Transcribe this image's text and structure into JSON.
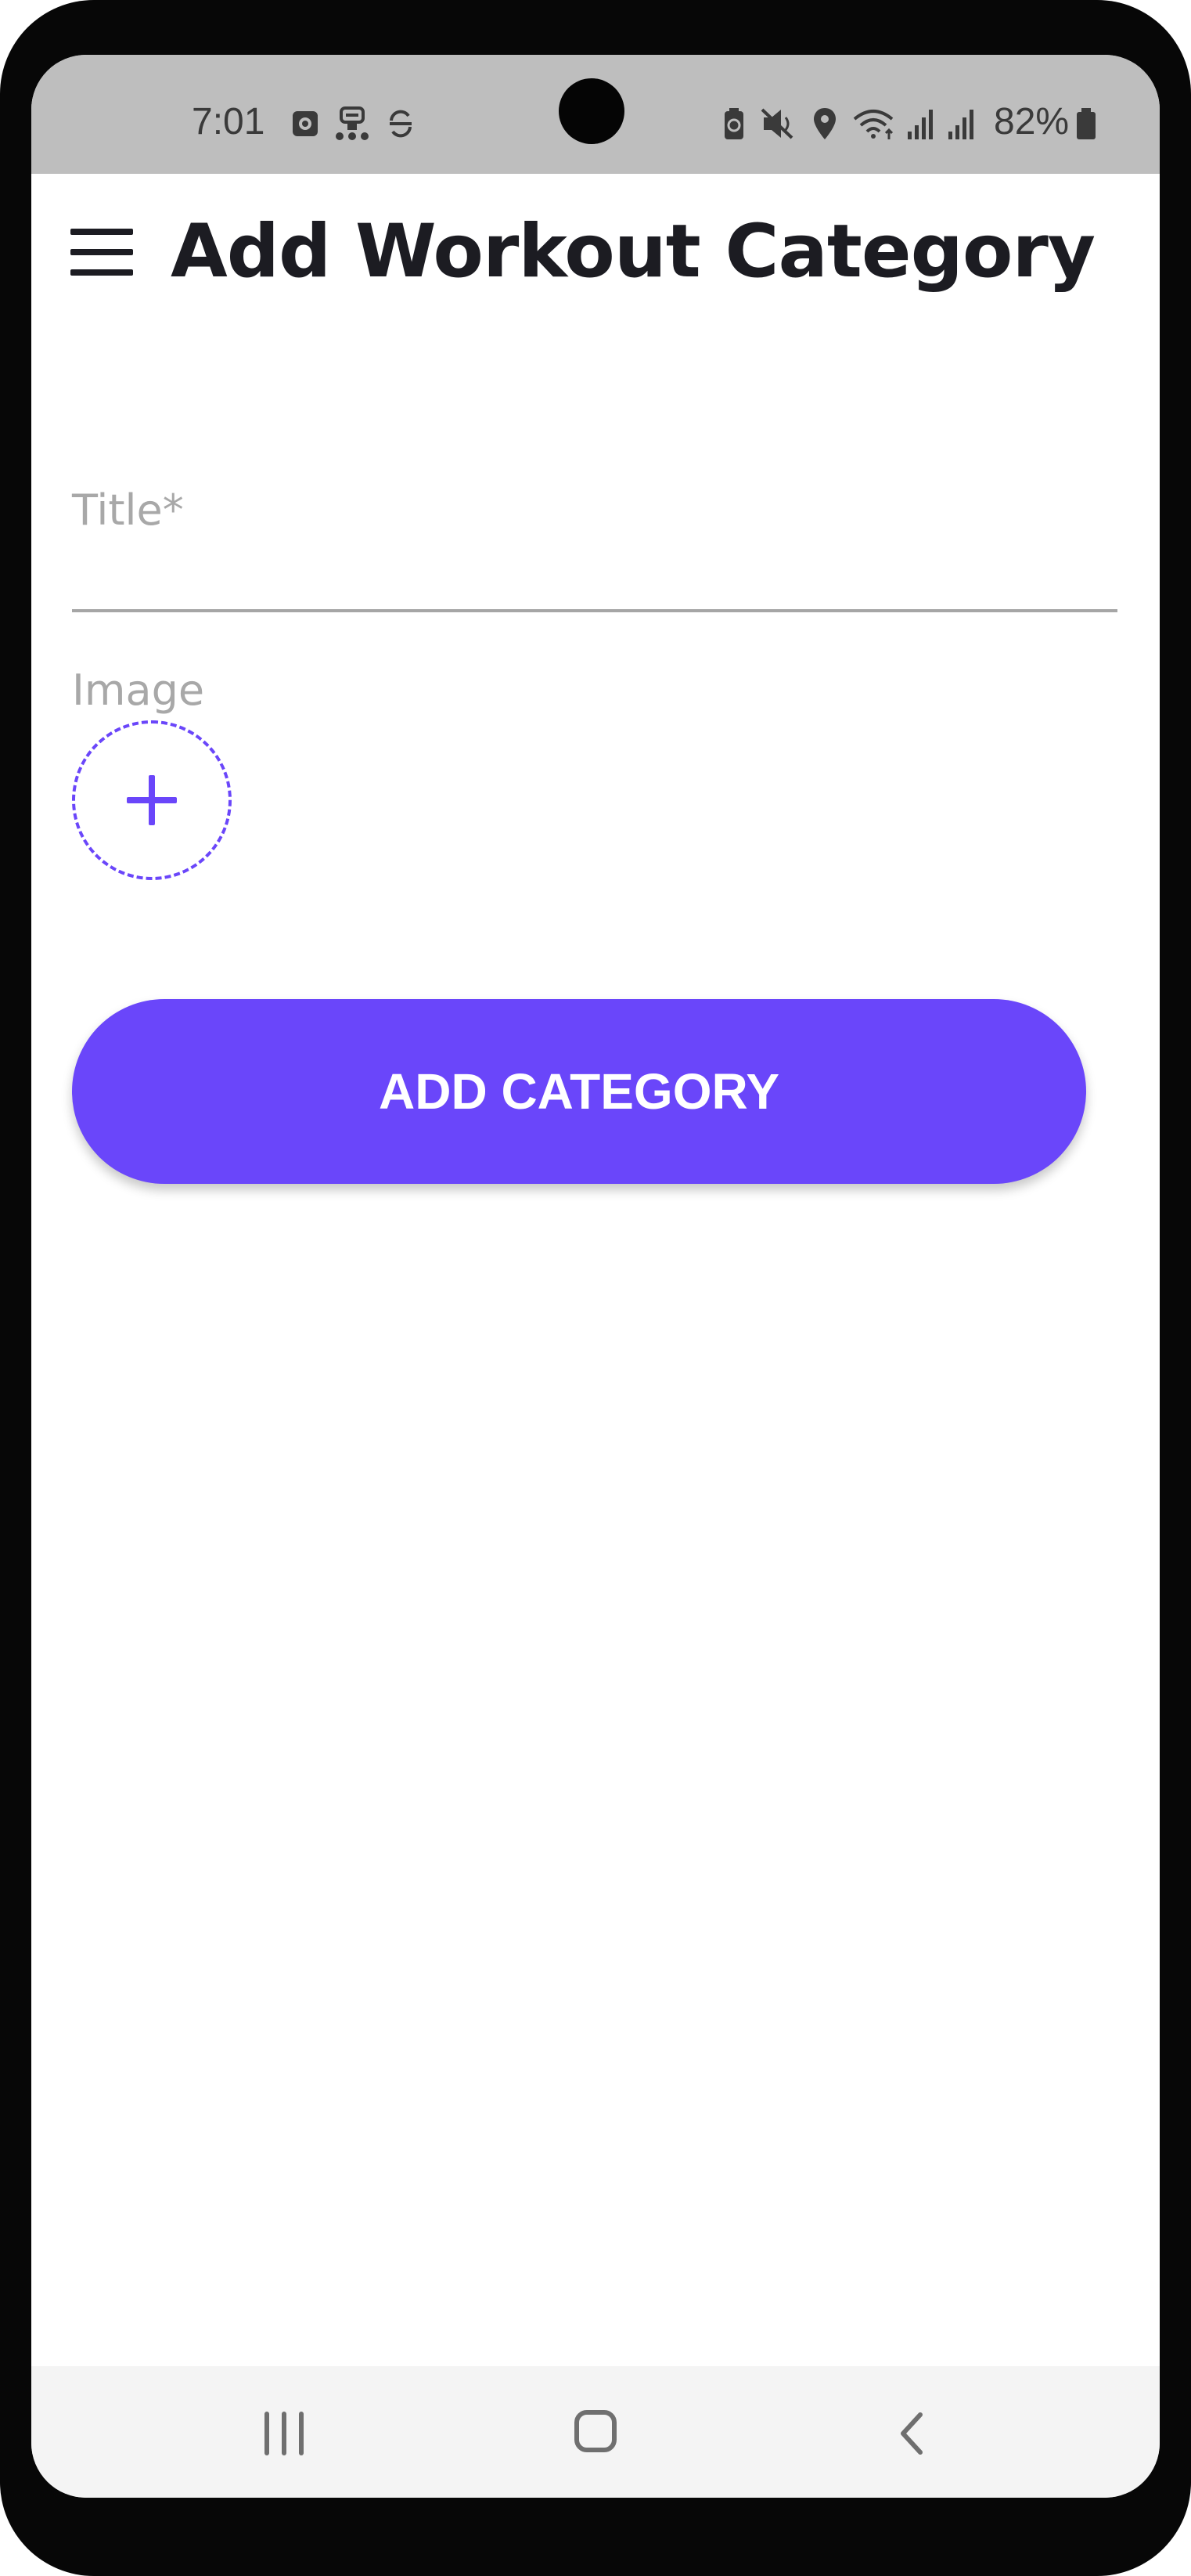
{
  "status_bar": {
    "time": "7:01",
    "battery_percent": "82%",
    "icons": [
      "app-notification-icon",
      "robot-icon",
      "sync-icon",
      "battery-saver-icon",
      "mute-icon",
      "location-icon",
      "wifi-icon",
      "signal-icon",
      "signal-icon",
      "battery-icon"
    ]
  },
  "app_bar": {
    "title": "Add Workout Category",
    "menu_icon": "hamburger-menu-icon"
  },
  "form": {
    "title_label": "Title*",
    "title_value": "",
    "image_label": "Image",
    "image_picker_icon": "plus-icon",
    "submit_label": "ADD CATEGORY"
  },
  "nav_bar": {
    "buttons": [
      "recents-icon",
      "home-icon",
      "back-icon"
    ]
  },
  "colors": {
    "accent": "#6a46fa",
    "status_bar_bg": "#bebebe",
    "title_text": "#1c1c22",
    "hint_text": "#a8a8a8"
  }
}
